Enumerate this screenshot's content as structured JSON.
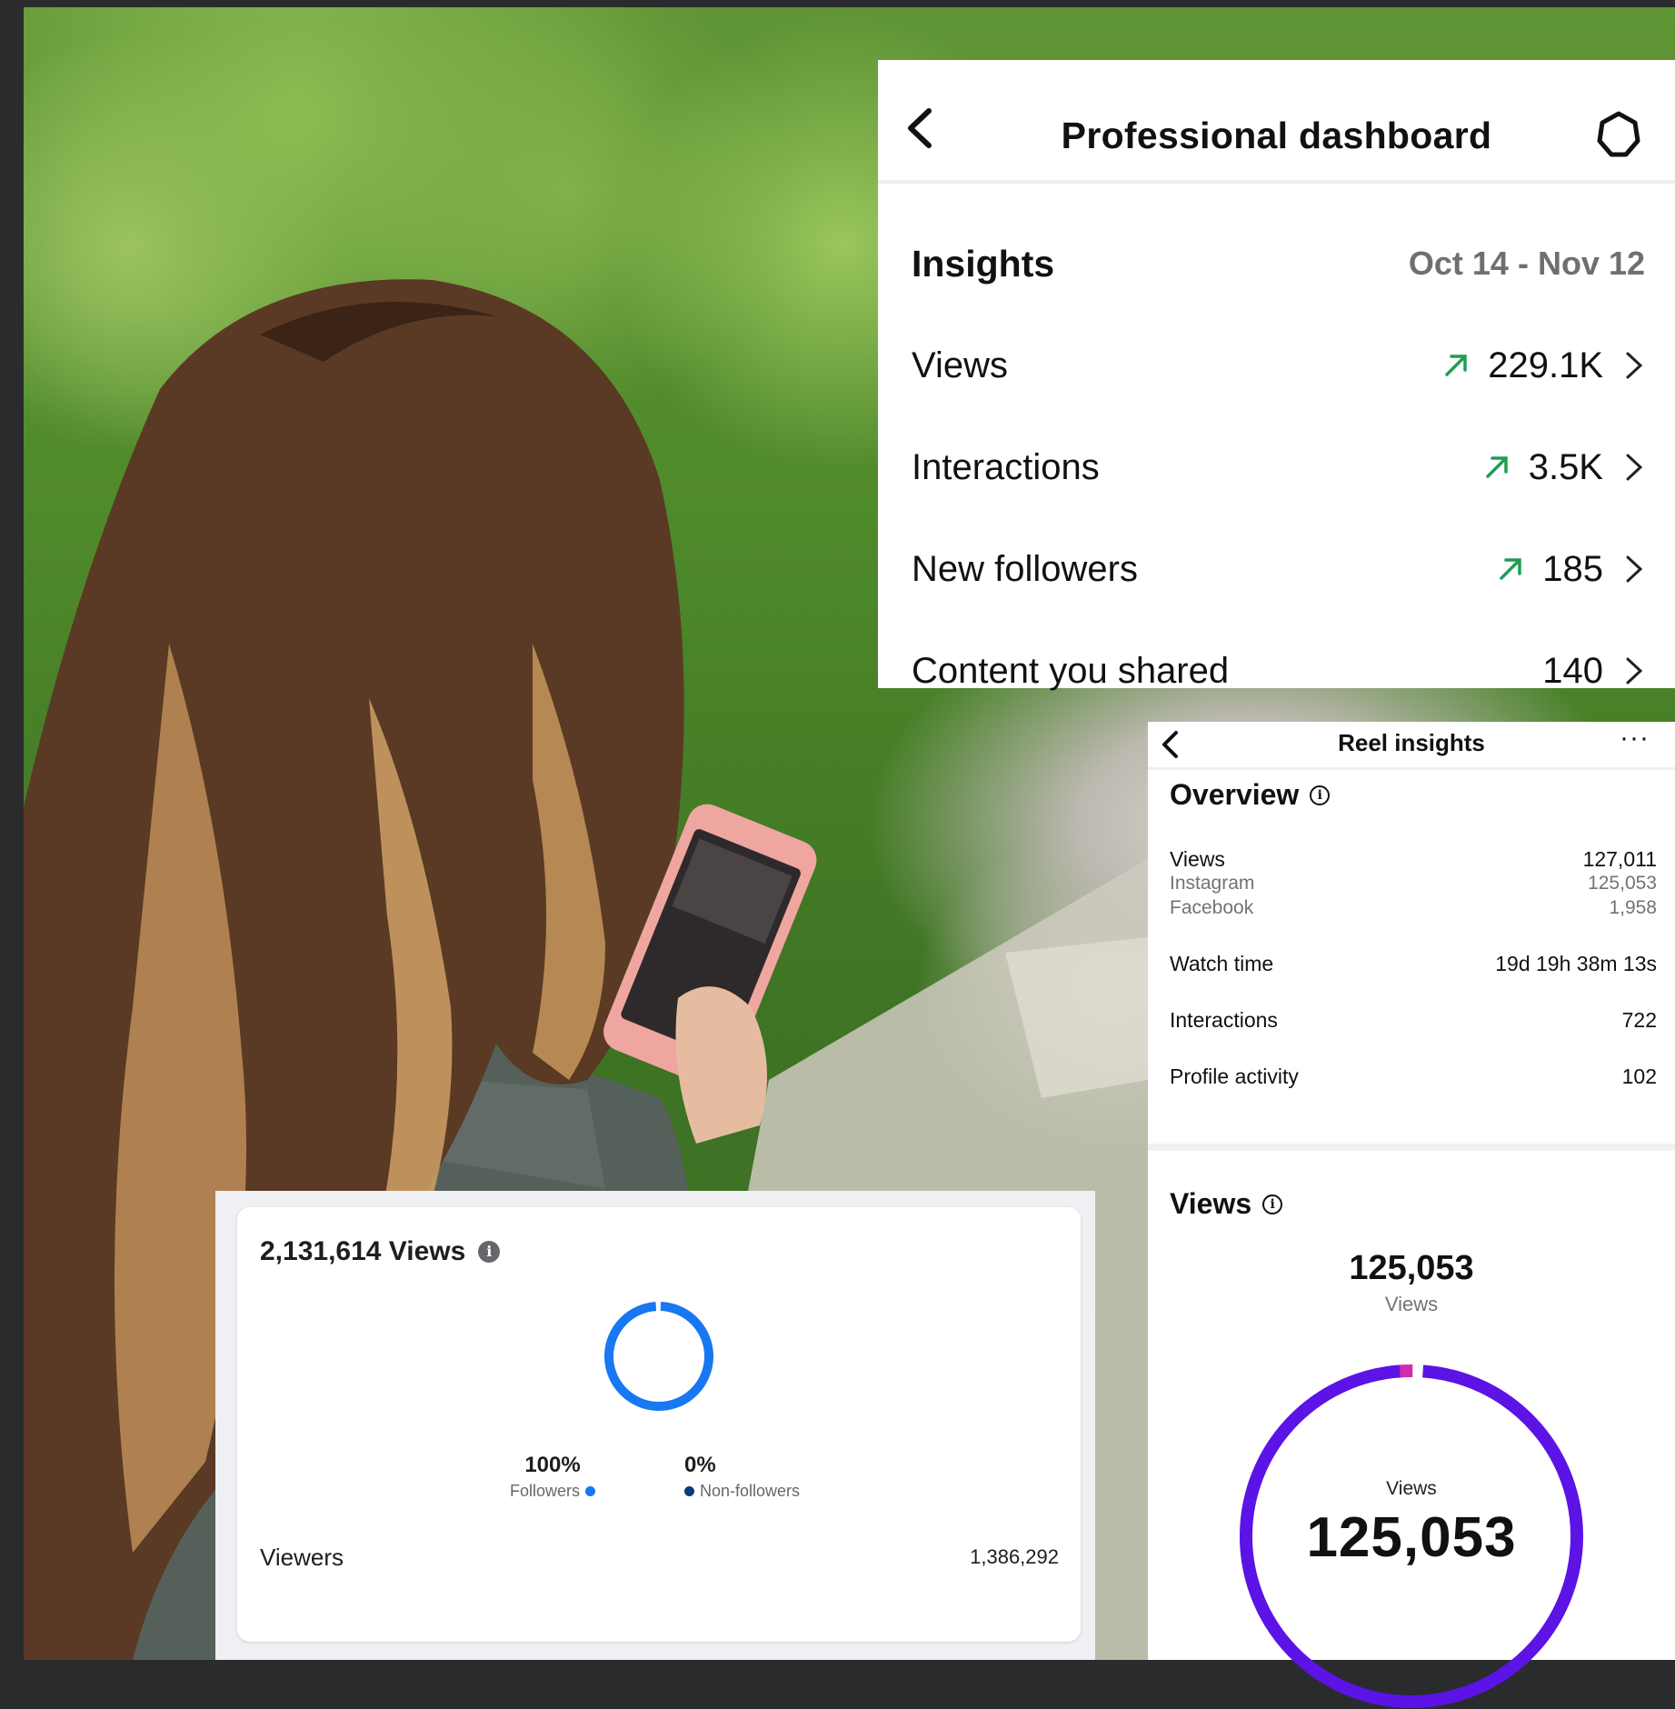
{
  "professional_dashboard": {
    "title": "Professional dashboard",
    "section_title": "Insights",
    "date_range": "Oct 14 - Nov 12",
    "rows": [
      {
        "label": "Views",
        "value": "229.1K",
        "trend": "up"
      },
      {
        "label": "Interactions",
        "value": "3.5K",
        "trend": "up"
      },
      {
        "label": "New followers",
        "value": "185",
        "trend": "up"
      },
      {
        "label": "Content you shared",
        "value": "140",
        "trend": "none"
      }
    ],
    "trend_color": "#1f9d55"
  },
  "reel_insights": {
    "title": "Reel insights",
    "more": "···",
    "overview_title": "Overview",
    "views_label": "Views",
    "views_value": "127,011",
    "instagram_label": "Instagram",
    "instagram_value": "125,053",
    "facebook_label": "Facebook",
    "facebook_value": "1,958",
    "watch_time_label": "Watch time",
    "watch_time_value": "19d 19h 38m 13s",
    "interactions_label": "Interactions",
    "interactions_value": "722",
    "profile_activity_label": "Profile activity",
    "profile_activity_value": "102",
    "views_section_title": "Views",
    "views_total": "125,053",
    "views_total_label": "Views",
    "donut_label": "Views",
    "donut_value": "125,053",
    "donut_colors": {
      "main": "#5b13e6",
      "accent": "#d42ab0"
    }
  },
  "facebook_views": {
    "title": "2,131,614 Views",
    "followers_pct": "100%",
    "followers_label": "Followers",
    "nonfollowers_pct": "0%",
    "nonfollowers_label": "Non-followers",
    "followers_color": "#1877f2",
    "nonfollowers_color": "#0b3b7a",
    "viewers_label": "Viewers",
    "viewers_value": "1,386,292"
  }
}
